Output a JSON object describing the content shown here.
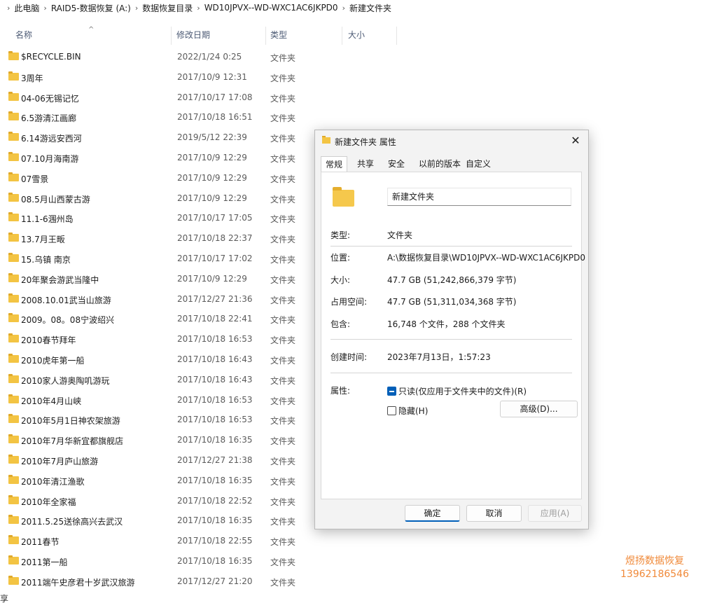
{
  "breadcrumb": [
    "此电脑",
    "RAID5-数据恢复 (A:)",
    "数据恢复目录",
    "WD10JPVX--WD-WXC1AC6JKPD0",
    "新建文件夹"
  ],
  "columns": {
    "name": "名称",
    "date": "修改日期",
    "type": "类型",
    "size": "大小"
  },
  "files": [
    {
      "name": "$RECYCLE.BIN",
      "date": "2022/1/24 0:25",
      "type": "文件夹"
    },
    {
      "name": "3周年",
      "date": "2017/10/9 12:31",
      "type": "文件夹"
    },
    {
      "name": "04-06无锡记忆",
      "date": "2017/10/17 17:08",
      "type": "文件夹"
    },
    {
      "name": "6.5游清江画廊",
      "date": "2017/10/18 16:51",
      "type": "文件夹"
    },
    {
      "name": "6.14游远安西河",
      "date": "2019/5/12 22:39",
      "type": "文件夹"
    },
    {
      "name": "07.10月海南游",
      "date": "2017/10/9 12:29",
      "type": "文件夹"
    },
    {
      "name": "07雪景",
      "date": "2017/10/9 12:29",
      "type": "文件夹"
    },
    {
      "name": "08.5月山西蒙古游",
      "date": "2017/10/9 12:29",
      "type": "文件夹"
    },
    {
      "name": "11.1-6涠州岛",
      "date": "2017/10/17 17:05",
      "type": "文件夹"
    },
    {
      "name": "13.7月王畈",
      "date": "2017/10/18 22:37",
      "type": "文件夹"
    },
    {
      "name": "15.乌镇 南京",
      "date": "2017/10/17 17:02",
      "type": "文件夹"
    },
    {
      "name": "20年聚会游武当隆中",
      "date": "2017/10/9 12:29",
      "type": "文件夹"
    },
    {
      "name": "2008.10.01武当山旅游",
      "date": "2017/12/27 21:36",
      "type": "文件夹"
    },
    {
      "name": "2009。08。08宁波绍兴",
      "date": "2017/10/18 22:41",
      "type": "文件夹"
    },
    {
      "name": "2010春节拜年",
      "date": "2017/10/18 16:53",
      "type": "文件夹"
    },
    {
      "name": "2010虎年第一船",
      "date": "2017/10/18 16:43",
      "type": "文件夹"
    },
    {
      "name": "2010家人游奥陶叽游玩",
      "date": "2017/10/18 16:43",
      "type": "文件夹"
    },
    {
      "name": "2010年4月山峡",
      "date": "2017/10/18 16:53",
      "type": "文件夹"
    },
    {
      "name": "2010年5月1日神农架旅游",
      "date": "2017/10/18 16:53",
      "type": "文件夹"
    },
    {
      "name": "2010年7月华新宜都旗舰店",
      "date": "2017/10/18 16:35",
      "type": "文件夹"
    },
    {
      "name": "2010年7月庐山旅游",
      "date": "2017/12/27 21:38",
      "type": "文件夹"
    },
    {
      "name": "2010年清江渔歌",
      "date": "2017/10/18 16:35",
      "type": "文件夹"
    },
    {
      "name": "2010年全家福",
      "date": "2017/10/18 22:52",
      "type": "文件夹"
    },
    {
      "name": "2011.5.25送徐高兴去武汉",
      "date": "2017/10/18 16:35",
      "type": "文件夹"
    },
    {
      "name": "2011春节",
      "date": "2017/10/18 22:55",
      "type": "文件夹"
    },
    {
      "name": "2011第一船",
      "date": "2017/10/18 16:35",
      "type": "文件夹"
    },
    {
      "name": "2011端午史彦君十岁武汉旅游",
      "date": "2017/12/27 21:20",
      "type": "文件夹"
    }
  ],
  "bottom_cut_text": "享",
  "watermark": {
    "line1": "煜扬数据恢复",
    "line2": "13962186546"
  },
  "dialog": {
    "title": "新建文件夹 属性",
    "close_glyph": "✕",
    "tabs": [
      "常规",
      "共享",
      "安全",
      "以前的版本",
      "自定义"
    ],
    "folder_name": "新建文件夹",
    "props": {
      "type_label": "类型:",
      "type_value": "文件夹",
      "location_label": "位置:",
      "location_value": "A:\\数据恢复目录\\WD10JPVX--WD-WXC1AC6JKPD0",
      "size_label": "大小:",
      "size_value": "47.7 GB (51,242,866,379 字节)",
      "disk_label": "占用空间:",
      "disk_value": "47.7 GB (51,311,034,368 字节)",
      "contains_label": "包含:",
      "contains_value": "16,748 个文件，288 个文件夹",
      "created_label": "创建时间:",
      "created_value": "2023年7月13日，1:57:23",
      "attr_label": "属性:"
    },
    "readonly_label": "只读(仅应用于文件夹中的文件)(R)",
    "hidden_label": "隐藏(H)",
    "advanced_label": "高级(D)...",
    "ok_label": "确定",
    "cancel_label": "取消",
    "apply_label": "应用(A)"
  }
}
